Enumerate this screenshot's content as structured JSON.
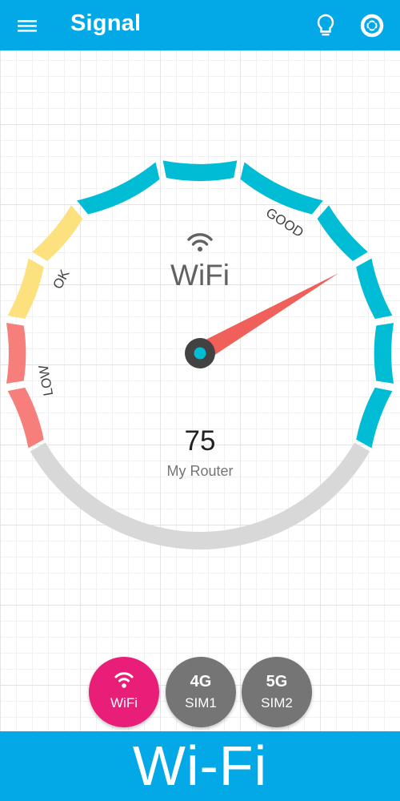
{
  "app_bar": {
    "title": "Signal",
    "menu_icon": "hamburger-menu-icon",
    "bulb_icon": "lightbulb-icon",
    "help_icon": "lifebuoy-icon"
  },
  "gauge": {
    "connection_label": "WiFi",
    "connection_icon": "wifi-icon",
    "value": "75",
    "signal_level": 75,
    "network_name": "My Router",
    "zone_labels": {
      "low": "LOW",
      "ok": "OK",
      "good": "GOOD"
    },
    "colors": {
      "low": "#f77f7b",
      "ok": "#fde17f",
      "good": "#00bcd4",
      "empty": "#d8d8d8",
      "needle": "#f0605b",
      "hub": "#424242",
      "hub_center": "#00bcd4"
    }
  },
  "sources": {
    "wifi": {
      "label": "WiFi",
      "icon": "wifi-icon",
      "selected": true,
      "color": "#e91e78"
    },
    "sim1": {
      "label_top": "4G",
      "label_bottom": "SIM1",
      "selected": false,
      "color": "#757575"
    },
    "sim2": {
      "label_top": "5G",
      "label_bottom": "SIM2",
      "selected": false,
      "color": "#757575"
    }
  },
  "banner": {
    "text": "Wi-Fi"
  },
  "colors": {
    "accent": "#03a9e7"
  }
}
